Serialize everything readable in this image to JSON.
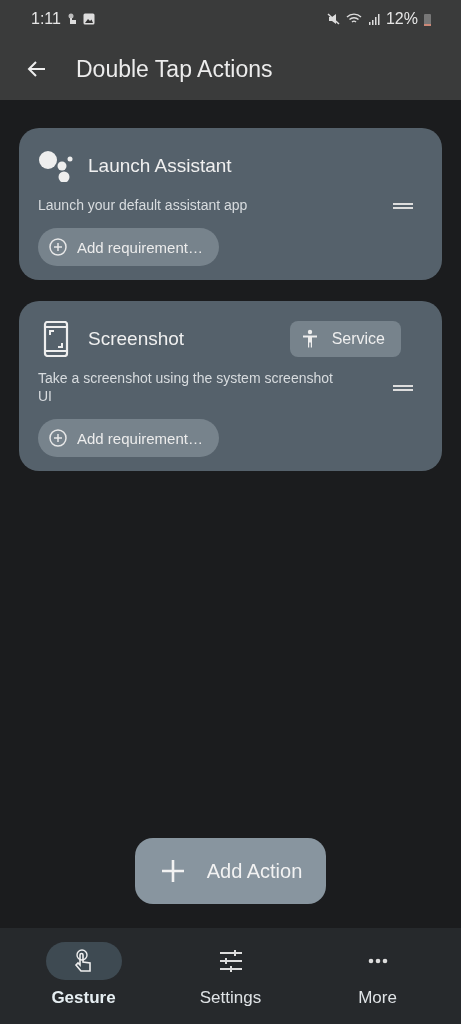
{
  "status_bar": {
    "time": "1:11",
    "battery": "12%"
  },
  "app_bar": {
    "title": "Double Tap Actions"
  },
  "actions": [
    {
      "kind": "assistant",
      "title": "Launch Assistant",
      "description": "Launch your default assistant app",
      "requirement_button": "Add requirement…"
    },
    {
      "kind": "screenshot",
      "title": "Screenshot",
      "badge": "Service",
      "description": "Take a screenshot using the system screenshot UI",
      "requirement_button": "Add requirement…"
    }
  ],
  "fab": {
    "label": "Add Action"
  },
  "nav": [
    {
      "kind": "gesture",
      "label": "Gesture",
      "selected": true
    },
    {
      "kind": "settings",
      "label": "Settings",
      "selected": false
    },
    {
      "kind": "more",
      "label": "More",
      "selected": false
    }
  ]
}
